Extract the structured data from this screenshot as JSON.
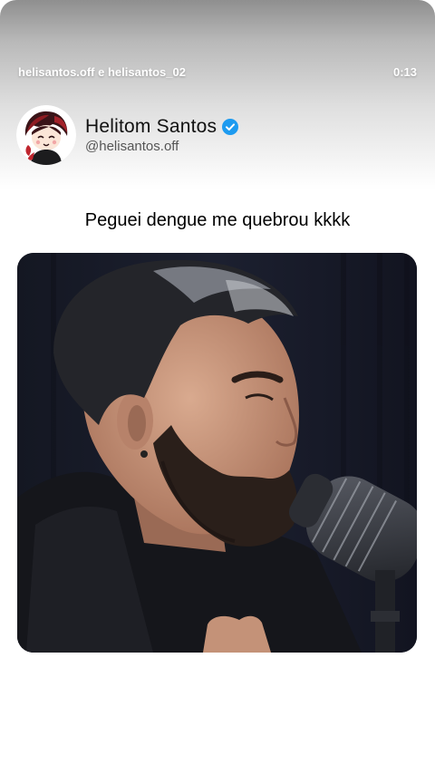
{
  "header": {
    "accounts": "helisantos.off e helisantos_02",
    "timestamp": "0:13"
  },
  "profile": {
    "display_name": "Helitom Santos",
    "handle": "@helisantos.off",
    "verified_icon": "verified-badge-icon",
    "verified_color": "#1d9bf0"
  },
  "post": {
    "caption": "Peguei dengue me quebrou kkkk",
    "media_description": "man-with-beard-speaking-into-microphone"
  }
}
